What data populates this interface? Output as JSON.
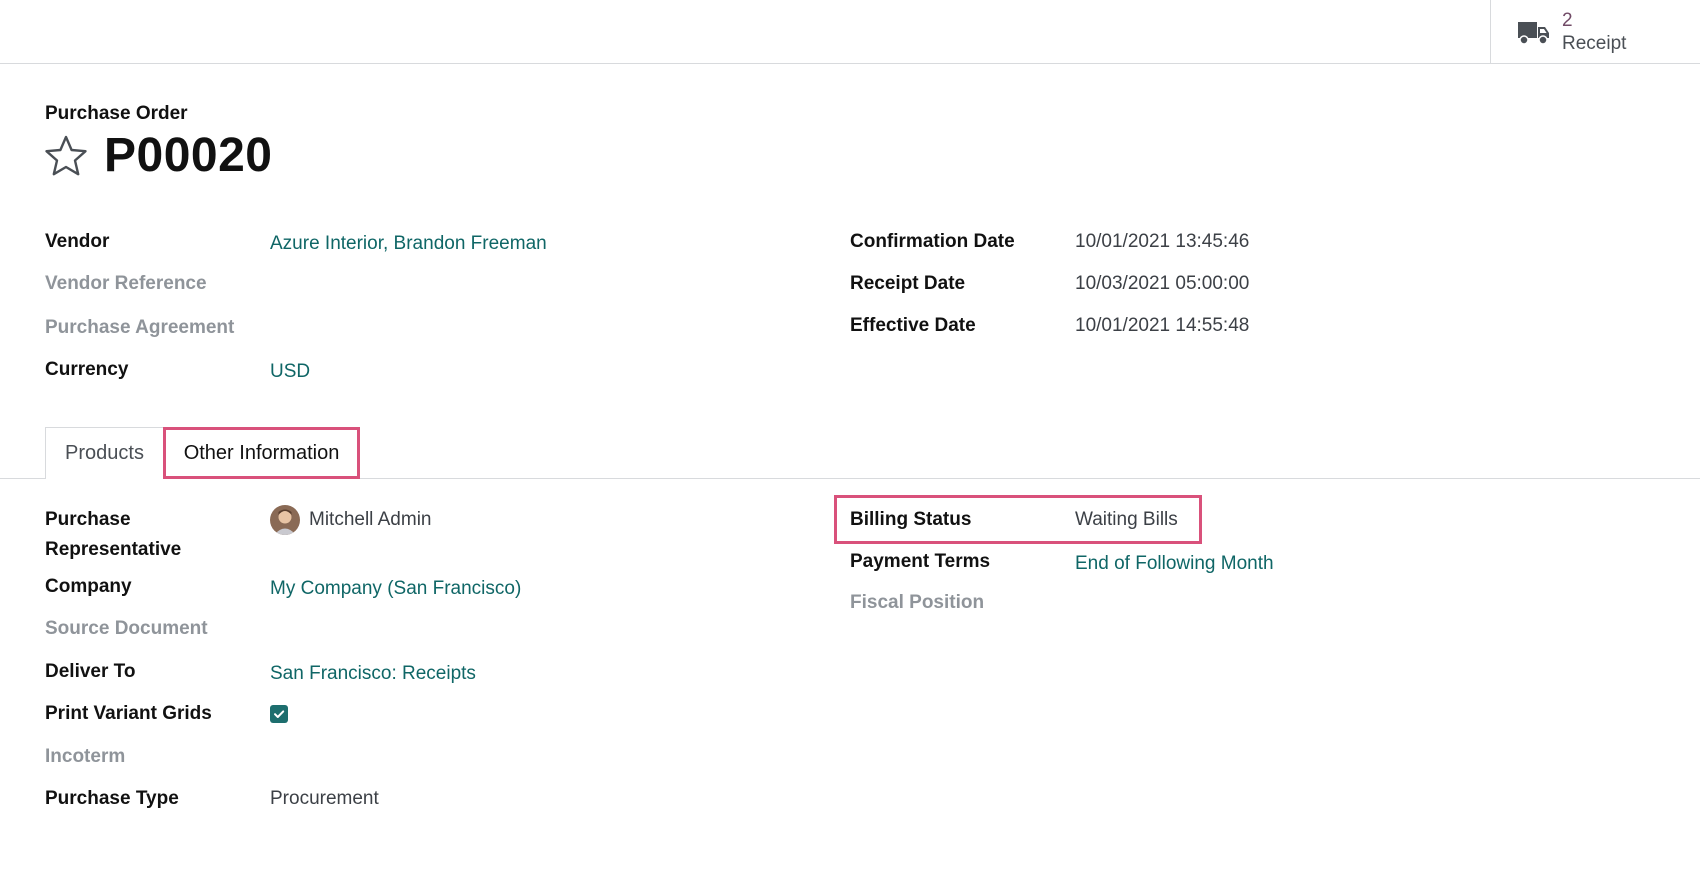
{
  "smart_button": {
    "count": "2",
    "label": "Receipt",
    "icon": "truck-icon"
  },
  "header": {
    "overline": "Purchase Order",
    "title": "P00020",
    "favorite_icon": "star-icon"
  },
  "main_fields": {
    "left": [
      {
        "label": "Vendor",
        "value": "Azure Interior, Brandon Freeman"
      },
      {
        "label": "Vendor Reference",
        "value": ""
      },
      {
        "label": "Purchase Agreement",
        "value": ""
      },
      {
        "label": "Currency",
        "value": "USD"
      }
    ],
    "right": [
      {
        "label": "Confirmation Date",
        "value": "10/01/2021 13:45:46"
      },
      {
        "label": "Receipt Date",
        "value": "10/03/2021 05:00:00"
      },
      {
        "label": "Effective Date",
        "value": "10/01/2021 14:55:48"
      }
    ]
  },
  "tabs": [
    {
      "label": "Products"
    },
    {
      "label": "Other Information"
    }
  ],
  "other_info": {
    "left": [
      {
        "label_line1": "Purchase",
        "label_line2": "Representative",
        "value": "Mitchell Admin"
      },
      {
        "label": "Company",
        "value": "My Company (San Francisco)"
      },
      {
        "label": "Source Document",
        "value": ""
      },
      {
        "label": "Deliver To",
        "value": "San Francisco: Receipts"
      },
      {
        "label": "Print Variant Grids",
        "checked": true
      },
      {
        "label": "Incoterm",
        "value": ""
      },
      {
        "label": "Purchase Type",
        "value": "Procurement"
      }
    ],
    "right": [
      {
        "label": "Billing Status",
        "value": "Waiting Bills"
      },
      {
        "label": "Payment Terms",
        "value": "End of Following Month"
      },
      {
        "label": "Fiscal Position",
        "value": ""
      }
    ]
  },
  "colors": {
    "link": "#0f6666",
    "highlight": "#d9517b",
    "brand": "#714B67",
    "muted_label": "#8f949a"
  }
}
